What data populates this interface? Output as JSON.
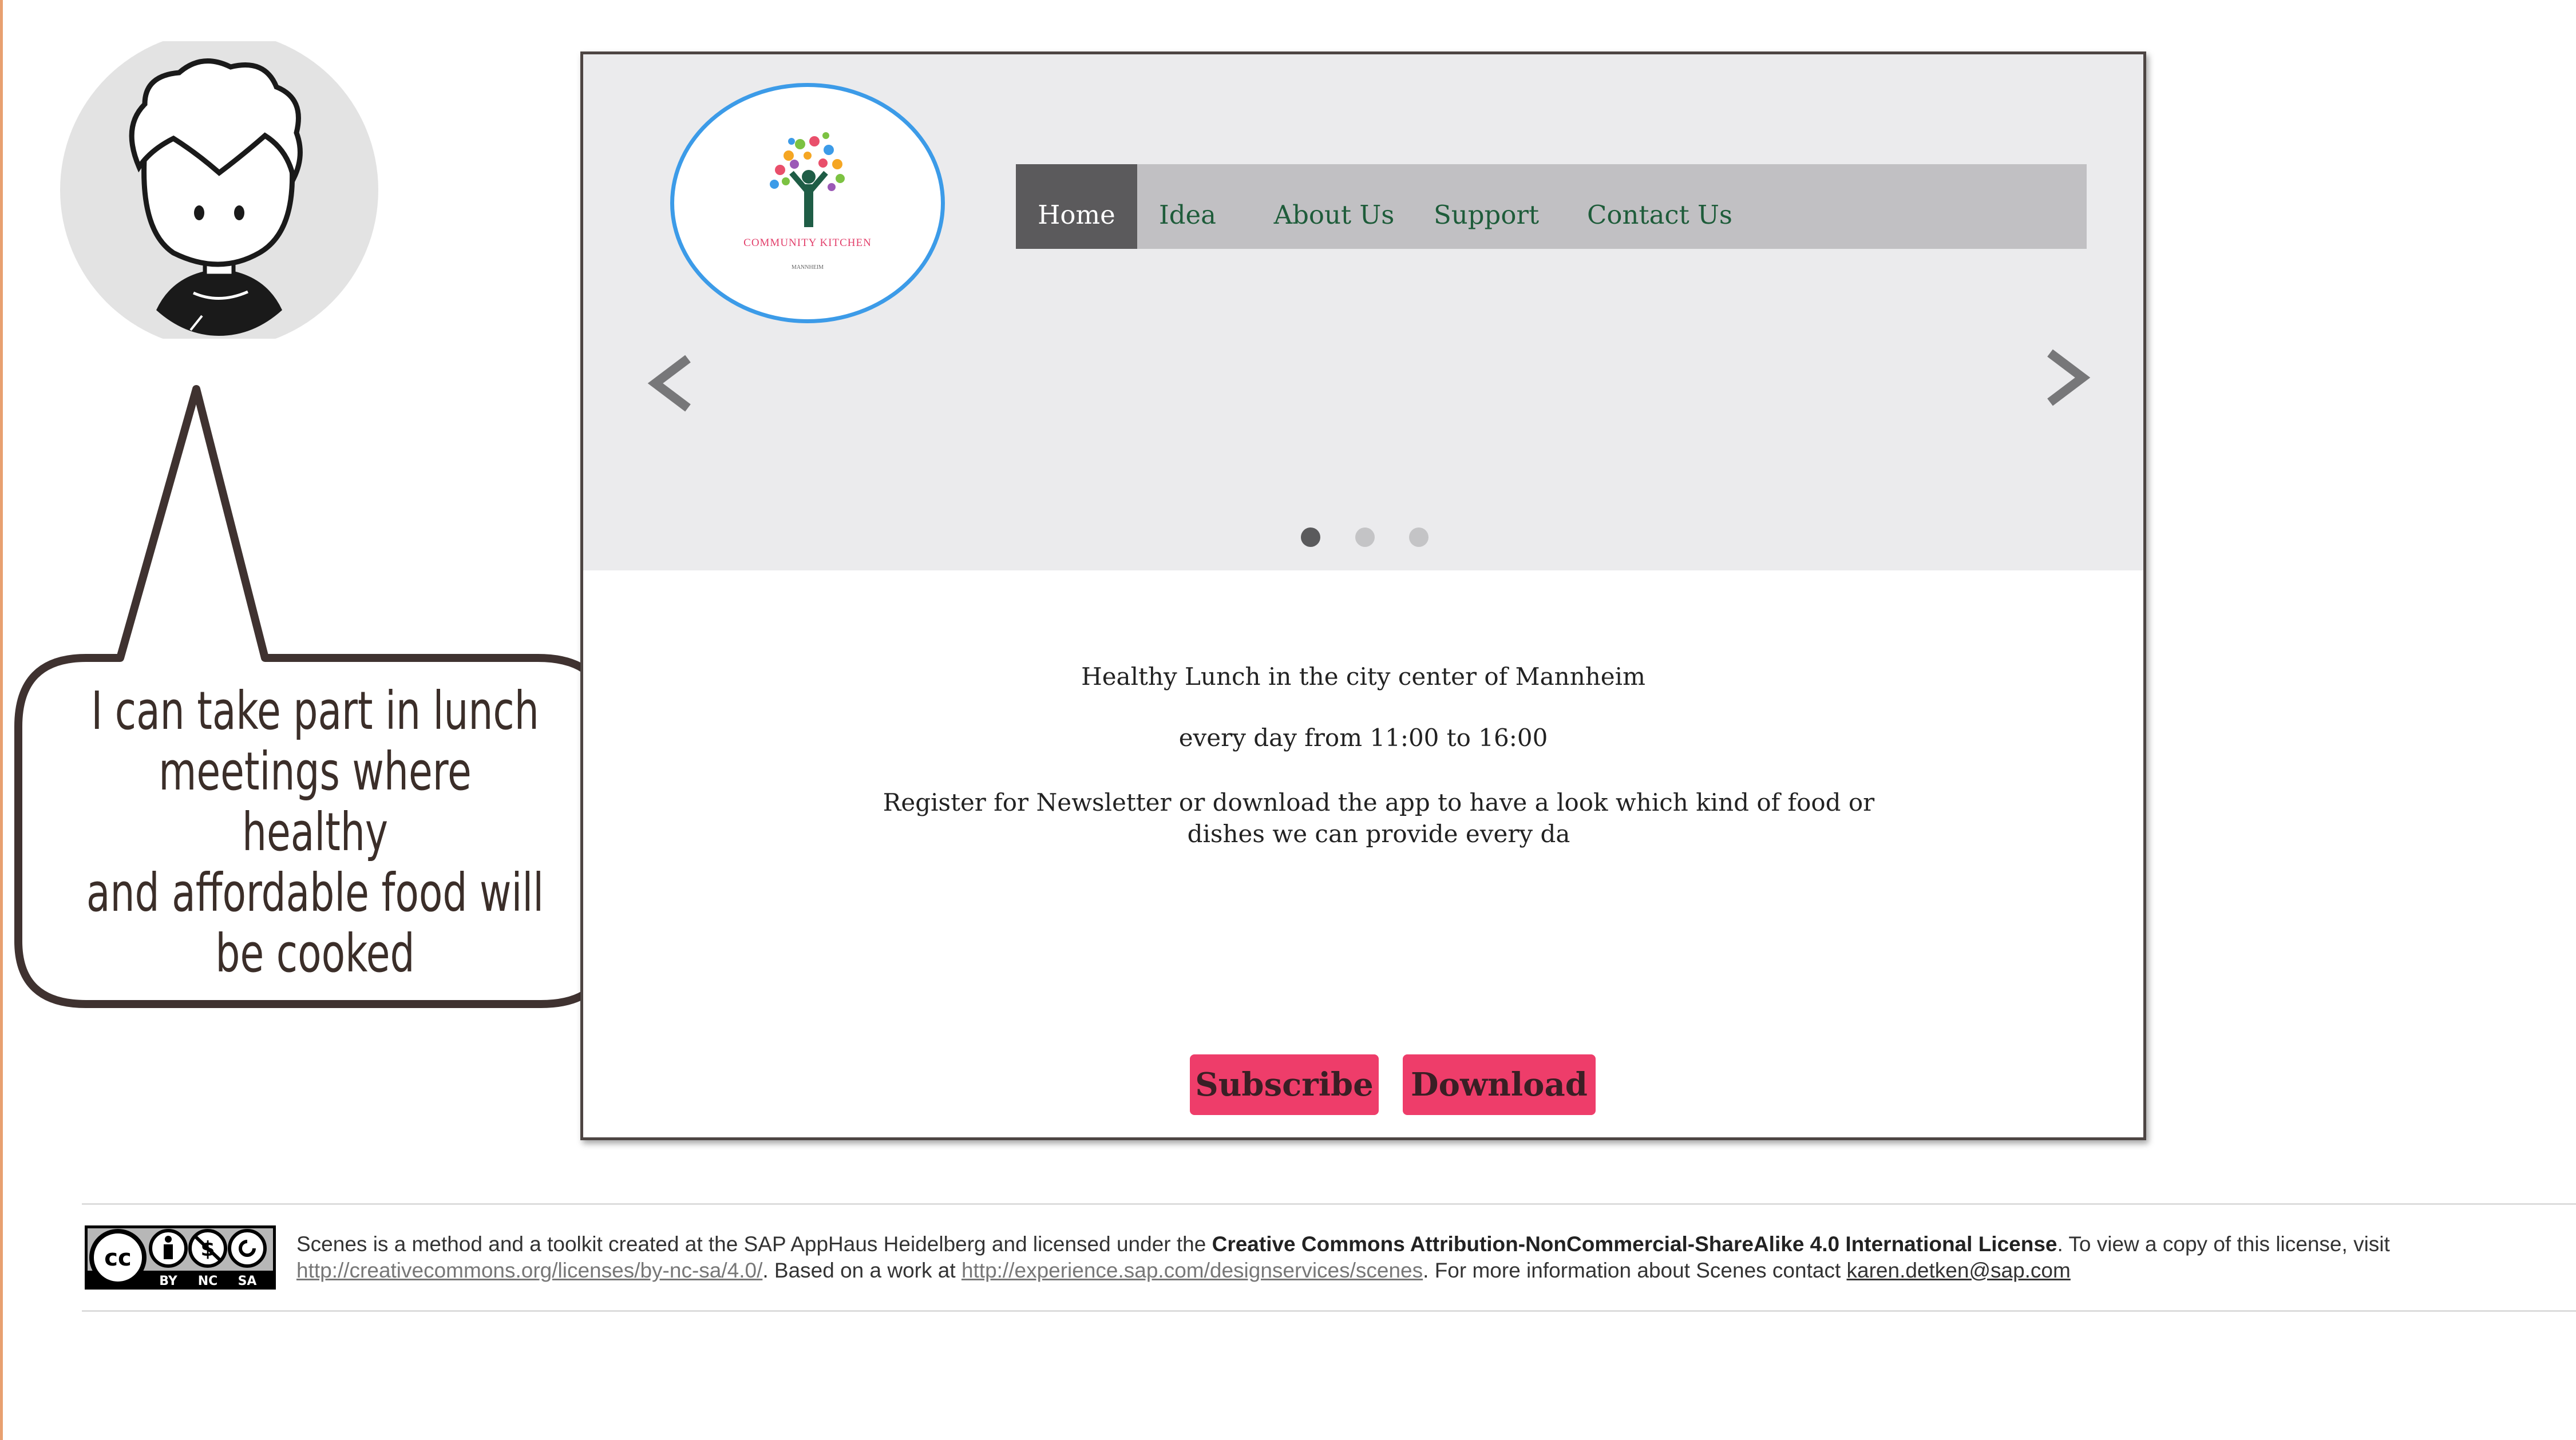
{
  "bubble": {
    "lines": [
      "I can take part in lunch",
      "meetings where healthy",
      "and affordable food will",
      "be cooked"
    ]
  },
  "mockup": {
    "logo": {
      "caption": "COMMUNITY KITCHEN",
      "subcaption": "MANNHEIM"
    },
    "nav": {
      "items": [
        {
          "label": "Home",
          "active": true
        },
        {
          "label": "Idea",
          "active": false
        },
        {
          "label": "About Us",
          "active": false
        },
        {
          "label": "Support",
          "active": false
        },
        {
          "label": "Contact Us",
          "active": false
        }
      ]
    },
    "carousel": {
      "prev_icon": "chevron-left-icon",
      "next_icon": "chevron-right-icon",
      "slide_count": 3,
      "active_slide": 1
    },
    "content": {
      "headline": "Healthy Lunch in the city center of Mannheim",
      "hours": "every day from 11:00 to 16:00",
      "description_line1": "Register for Newsletter or download the app to have a look which kind of food or",
      "description_line2": "dishes we can provide every da"
    },
    "buttons": {
      "subscribe": "Subscribe",
      "download": "Download"
    }
  },
  "footer": {
    "badge": {
      "labels": [
        "BY",
        "NC",
        "SA"
      ]
    },
    "text_part1": "Scenes is a method and a toolkit created at the SAP AppHaus Heidelberg and licensed under the ",
    "license_name": "Creative Commons Attribution-NonCommercial-ShareAlike 4.0 International License",
    "text_part2": ". To view a copy of this license, visit ",
    "license_url": "http://creativecommons.org/licenses/by-nc-sa/4.0/",
    "text_part3": ".  Based on a work at ",
    "work_url": "http://experience.sap.com/designservices/scenes",
    "text_part4": ". For more information about Scenes contact ",
    "contact_email": "karen.detken@sap.com"
  },
  "colors": {
    "accent": "#ee3d6a",
    "nav_text": "#1e5c3a",
    "logo_ring": "#3c9be8"
  }
}
